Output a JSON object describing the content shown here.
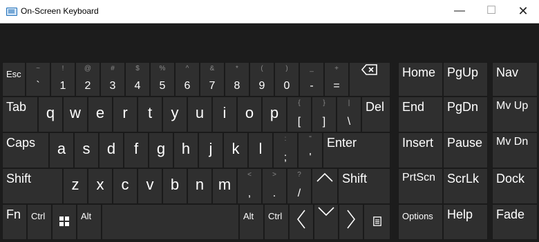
{
  "window": {
    "title": "On-Screen Keyboard",
    "minimize": "—",
    "maximize": "☐",
    "close": "✕"
  },
  "keys": {
    "esc": "Esc",
    "tilde": {
      "top": "~",
      "main": "`"
    },
    "n1": {
      "top": "!",
      "main": "1"
    },
    "n2": {
      "top": "@",
      "main": "2"
    },
    "n3": {
      "top": "#",
      "main": "3"
    },
    "n4": {
      "top": "$",
      "main": "4"
    },
    "n5": {
      "top": "%",
      "main": "5"
    },
    "n6": {
      "top": "^",
      "main": "6"
    },
    "n7": {
      "top": "&",
      "main": "7"
    },
    "n8": {
      "top": "*",
      "main": "8"
    },
    "n9": {
      "top": "(",
      "main": "9"
    },
    "n0": {
      "top": ")",
      "main": "0"
    },
    "minus": {
      "top": "_",
      "main": "-"
    },
    "equals": {
      "top": "+",
      "main": "="
    },
    "tab": "Tab",
    "q": "q",
    "w": "w",
    "e": "e",
    "r": "r",
    "t": "t",
    "y": "y",
    "u": "u",
    "i": "i",
    "o": "o",
    "p": "p",
    "lbracket": {
      "top": "{",
      "main": "["
    },
    "rbracket": {
      "top": "}",
      "main": "]"
    },
    "backslash": {
      "top": "|",
      "main": "\\"
    },
    "del": "Del",
    "caps": "Caps",
    "a": "a",
    "s": "s",
    "d": "d",
    "f": "f",
    "g": "g",
    "h": "h",
    "j": "j",
    "k": "k",
    "l": "l",
    "semicolon": {
      "top": ":",
      "main": ";"
    },
    "quote": {
      "top": "\"",
      "main": "'"
    },
    "enter": "Enter",
    "shift_left": "Shift",
    "z": "z",
    "x": "x",
    "c": "c",
    "v": "v",
    "b": "b",
    "n": "n",
    "m": "m",
    "comma": {
      "top": "<",
      "main": ","
    },
    "period": {
      "top": ">",
      "main": "."
    },
    "slash": {
      "top": "?",
      "main": "/"
    },
    "shift_right": "Shift",
    "fn": "Fn",
    "ctrl_left": "Ctrl",
    "alt_left": "Alt",
    "alt_right": "Alt",
    "ctrl_right": "Ctrl"
  },
  "side_keys": {
    "home": "Home",
    "pgup": "PgUp",
    "nav": "Nav",
    "end": "End",
    "pgdn": "PgDn",
    "mvup": "Mv Up",
    "insert": "Insert",
    "pause": "Pause",
    "mvdn": "Mv Dn",
    "prtscn": "PrtScn",
    "scrlk": "ScrLk",
    "dock": "Dock",
    "options": "Options",
    "help": "Help",
    "fade": "Fade"
  },
  "icons": {
    "backspace": "backspace-icon",
    "windows": "windows-icon",
    "arrow_up": "arrow-up-icon",
    "arrow_left": "arrow-left-icon",
    "arrow_down": "arrow-down-icon",
    "arrow_right": "arrow-right-icon",
    "menu": "context-menu-icon"
  }
}
